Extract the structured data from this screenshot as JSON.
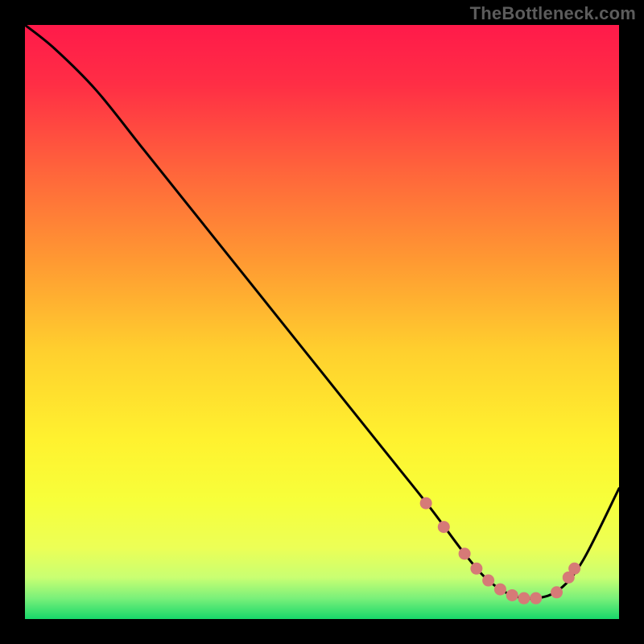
{
  "watermark": "TheBottleneck.com",
  "colors": {
    "frame": "#000000",
    "curve": "#000000",
    "dot": "#d67a77",
    "bottom_band": "#17d86a"
  },
  "chart_data": {
    "type": "line",
    "title": "",
    "xlabel": "",
    "ylabel": "",
    "xlim": [
      0,
      100
    ],
    "ylim": [
      0,
      100
    ],
    "series": [
      {
        "name": "curve",
        "x": [
          0,
          5,
          12,
          20,
          30,
          40,
          50,
          60,
          68,
          74,
          78,
          82,
          86,
          90,
          94,
          100
        ],
        "y": [
          100,
          96,
          89,
          79,
          66.5,
          54,
          41.5,
          29,
          19,
          11,
          6.5,
          4,
          3.5,
          5,
          10,
          22
        ]
      }
    ],
    "marker_points": {
      "x": [
        67.5,
        70.5,
        74,
        76,
        78,
        80,
        82,
        84,
        86,
        89.5,
        91.5,
        92.5
      ],
      "y": [
        19.5,
        15.5,
        11,
        8.5,
        6.5,
        5,
        4,
        3.5,
        3.5,
        4.5,
        7,
        8.5
      ]
    },
    "gradient_stops": [
      {
        "offset": 0.0,
        "color": "#ff1a4a"
      },
      {
        "offset": 0.1,
        "color": "#ff2e45"
      },
      {
        "offset": 0.25,
        "color": "#ff663b"
      },
      {
        "offset": 0.4,
        "color": "#ff9a32"
      },
      {
        "offset": 0.55,
        "color": "#ffd02e"
      },
      {
        "offset": 0.7,
        "color": "#fff22f"
      },
      {
        "offset": 0.8,
        "color": "#f7ff3a"
      },
      {
        "offset": 0.88,
        "color": "#ecff56"
      },
      {
        "offset": 0.93,
        "color": "#c9ff72"
      },
      {
        "offset": 0.965,
        "color": "#7af07a"
      },
      {
        "offset": 1.0,
        "color": "#17d86a"
      }
    ]
  }
}
